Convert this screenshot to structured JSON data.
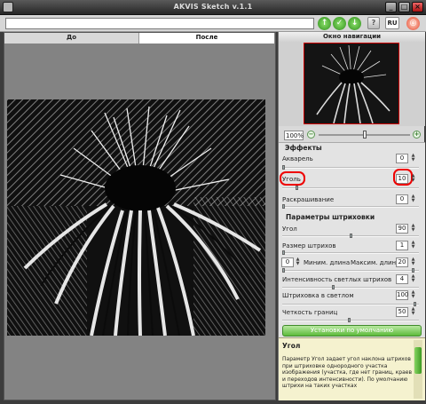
{
  "window": {
    "title": "AKVIS Sketch v.1.1"
  },
  "toolbar": {
    "path_value": "",
    "buttons": [
      "open-icon",
      "run-icon",
      "save-icon",
      "help-icon"
    ],
    "language_label": "RU",
    "logo_icon": "akvis-logo-icon"
  },
  "view_tabs": {
    "before": "До",
    "after": "После",
    "active": "После"
  },
  "navigator": {
    "title": "Окно навигации",
    "zoom_value": "100%"
  },
  "effects": {
    "header": "Эффекты",
    "params": [
      {
        "label": "Акварель",
        "value": "0"
      },
      {
        "label": "Уголь",
        "value": "10"
      },
      {
        "label": "Раскрашивание",
        "value": "0"
      }
    ]
  },
  "strokes": {
    "header": "Параметры штриховки",
    "angle": {
      "label": "Угол",
      "value": "90"
    },
    "size": {
      "label": "Размер штрихов",
      "value": "1"
    },
    "length": {
      "min_value": "0",
      "min_label": "Миним. длина",
      "max_label": "Максим. длина",
      "max_value": "20"
    },
    "light_intensity": {
      "label": "Интенсивность светлых штрихов",
      "value": "4"
    },
    "light_hatching": {
      "label": "Штриховка в светлом",
      "value": "100"
    },
    "edge_sharpness": {
      "label": "Четкость границ",
      "value": "50"
    }
  },
  "default_button_label": "Установки по умолчанию",
  "help": {
    "title": "Угол",
    "text": "Параметр Угол задает угол наклона штрихов при штриховке однородного участка изображения (участка, где нет границ, краев и переходов интенсивности). По умолчанию штрихи на таких участках"
  },
  "colors": {
    "accent": "#5dbb3b",
    "highlight_ring": "#e00000"
  }
}
